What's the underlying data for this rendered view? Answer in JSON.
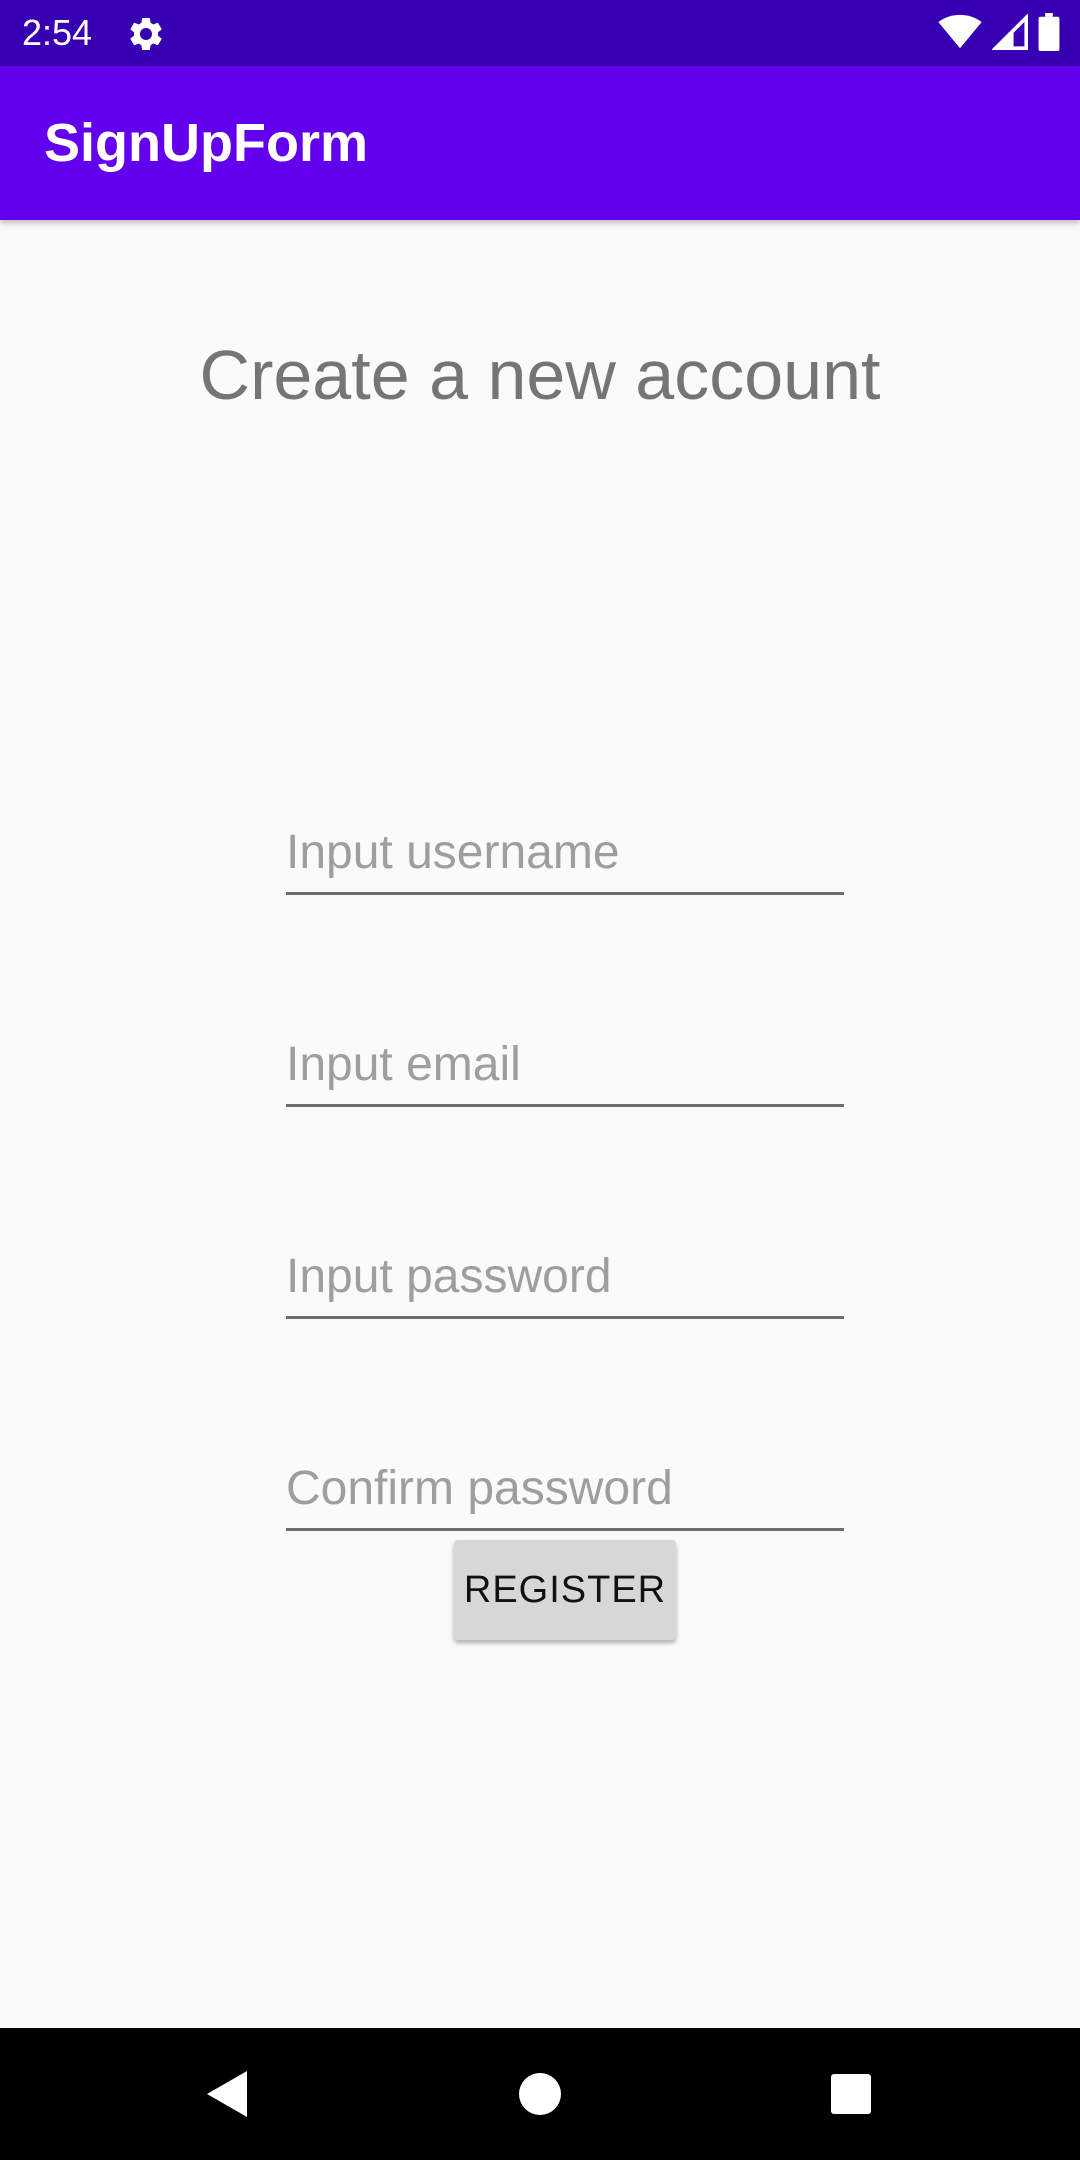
{
  "status_bar": {
    "time": "2:54",
    "icons": [
      "settings-icon",
      "wifi-icon",
      "signal-icon",
      "battery-icon"
    ]
  },
  "app_bar": {
    "title": "SignUpForm"
  },
  "form": {
    "heading": "Create a new account",
    "fields": [
      {
        "name": "username",
        "value": "",
        "placeholder": "Input username"
      },
      {
        "name": "email",
        "value": "",
        "placeholder": "Input email"
      },
      {
        "name": "password",
        "value": "",
        "placeholder": "Input password"
      },
      {
        "name": "confirm_password",
        "value": "",
        "placeholder": "Confirm password"
      }
    ],
    "register_label": "REGISTER"
  },
  "nav_bar": {
    "buttons": [
      "back-icon",
      "home-icon",
      "recents-icon"
    ]
  },
  "colors": {
    "status_bar": "#3700b3",
    "app_bar": "#6200ee",
    "background": "#fafafa",
    "button": "#d6d7d7"
  }
}
